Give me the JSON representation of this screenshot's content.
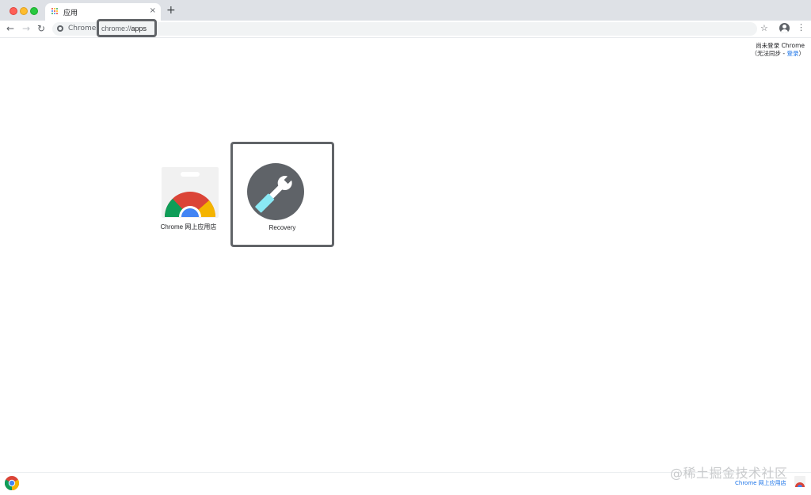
{
  "tab": {
    "title": "应用",
    "close_glyph": "×",
    "favicon_colors": [
      "#ea4335",
      "#fbbc04",
      "#34a853",
      "#4285f4",
      "#ea4335",
      "#fbbc04",
      "#34a853",
      "#4285f4",
      "#ea4335"
    ]
  },
  "new_tab_glyph": "+",
  "toolbar": {
    "back_glyph": "←",
    "forward_glyph": "→",
    "reload_glyph": "↻",
    "site_label": "Chrome",
    "url_prefix": "chrome://",
    "url_path": "apps",
    "star_glyph": "☆",
    "menu_glyph": "⋮"
  },
  "signin": {
    "line1": "尚未登录 Chrome",
    "line2_prefix": "（无法同步 - ",
    "line2_link": "登录",
    "line2_suffix": "）"
  },
  "apps": [
    {
      "label": "Chrome 网上应用店",
      "icon": "chrome-web-store-icon"
    },
    {
      "label": "Recovery",
      "icon": "recovery-wrench-icon"
    }
  ],
  "footer": {
    "store_link": "Chrome 网上应用店"
  },
  "watermark": "@稀土掘金技术社区",
  "colors": {
    "chrome_red": "#db4437",
    "chrome_green": "#0f9d58",
    "chrome_yellow": "#f4b400",
    "chrome_blue": "#4285f4",
    "recovery_dark": "#5f6368",
    "recovery_cyan": "#8ae9f5",
    "highlight_border": "#616468"
  }
}
